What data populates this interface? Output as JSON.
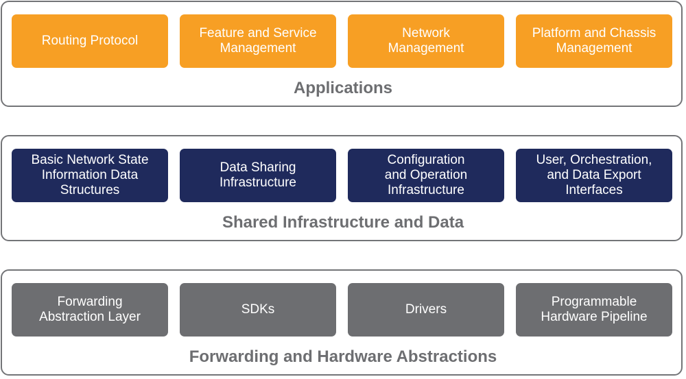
{
  "layers": [
    {
      "title": "Applications",
      "color": "#f79f24",
      "boxes": [
        "Routing Protocol",
        "Feature and Service\nManagement",
        "Network\nManagement",
        "Platform and Chassis\nManagement"
      ]
    },
    {
      "title": "Shared Infrastructure and Data",
      "color": "#1f2a5c",
      "boxes": [
        "Basic Network State\nInformation Data\nStructures",
        "Data Sharing\nInfrastructure",
        "Configuration\nand Operation\nInfrastructure",
        "User, Orchestration,\nand Data Export\nInterfaces"
      ]
    },
    {
      "title": "Forwarding and Hardware Abstractions",
      "color": "#6d6e71",
      "boxes": [
        "Forwarding\nAbstraction Layer",
        "SDKs",
        "Drivers",
        "Programmable\nHardware Pipeline"
      ]
    }
  ]
}
